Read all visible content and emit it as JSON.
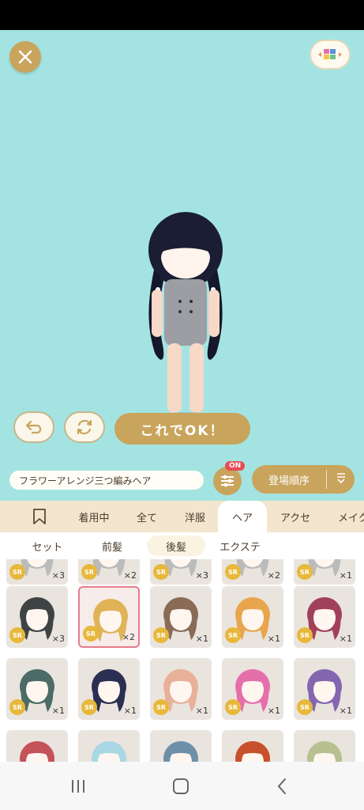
{
  "buttons": {
    "ok_label": "これでOK！"
  },
  "toolbar": {
    "item_name": "フラワーアレンジ三つ編みヘア",
    "filter_badge": "ON",
    "sort_label": "登場順序"
  },
  "category_tabs": [
    {
      "label": ""
    },
    {
      "label": "着用中"
    },
    {
      "label": "全て"
    },
    {
      "label": "洋服"
    },
    {
      "label": "ヘア"
    },
    {
      "label": "アクセ"
    },
    {
      "label": "メイク"
    }
  ],
  "active_category": "ヘア",
  "sub_tabs": [
    {
      "label": "セット"
    },
    {
      "label": "前髪"
    },
    {
      "label": "後髪"
    },
    {
      "label": "エクステ"
    }
  ],
  "active_sub_tab": "後髪",
  "items": [
    {
      "rarity": "SR",
      "qty": "×3"
    },
    {
      "rarity": "SR",
      "qty": "×2"
    },
    {
      "rarity": "SR",
      "qty": "×3"
    },
    {
      "rarity": "SR",
      "qty": "×2"
    },
    {
      "rarity": "SR",
      "qty": "×1"
    },
    {
      "rarity": "SR",
      "qty": "×3",
      "hair": "#3e4444"
    },
    {
      "rarity": "SR",
      "qty": "×2",
      "hair": "#e0b357",
      "selected": true
    },
    {
      "rarity": "SR",
      "qty": "×1",
      "hair": "#8a6b58"
    },
    {
      "rarity": "SR",
      "qty": "×1",
      "hair": "#e9a54e"
    },
    {
      "rarity": "SR",
      "qty": "×1",
      "hair": "#a1405a"
    },
    {
      "rarity": "SR",
      "qty": "×1",
      "hair": "#4d6b66"
    },
    {
      "rarity": "SR",
      "qty": "×1",
      "hair": "#2b2f52"
    },
    {
      "rarity": "SR",
      "qty": "×1",
      "hair": "#e9b09a"
    },
    {
      "rarity": "SR",
      "qty": "×1",
      "hair": "#e56fab"
    },
    {
      "rarity": "SR",
      "qty": "×1",
      "hair": "#8466b0"
    },
    {
      "rarity": "",
      "qty": "",
      "hair": "#c5525a"
    },
    {
      "rarity": "",
      "qty": "",
      "hair": "#a9d7e4"
    },
    {
      "rarity": "",
      "qty": "",
      "hair": "#6e8fa8"
    },
    {
      "rarity": "",
      "qty": "",
      "hair": "#c8502d"
    },
    {
      "rarity": "",
      "qty": "",
      "hair": "#b8c08f"
    }
  ],
  "colors": {
    "gold": "#c9a45c",
    "stage": "#a3e4e2",
    "badge_red": "#e84a55",
    "selected_border": "#e77b8e"
  },
  "icons": [
    "close-icon",
    "cube-icon",
    "undo-icon",
    "refresh-icon",
    "filter-icon",
    "sort-icon",
    "bookmark-icon",
    "recent-apps-icon",
    "home-icon",
    "back-icon"
  ]
}
